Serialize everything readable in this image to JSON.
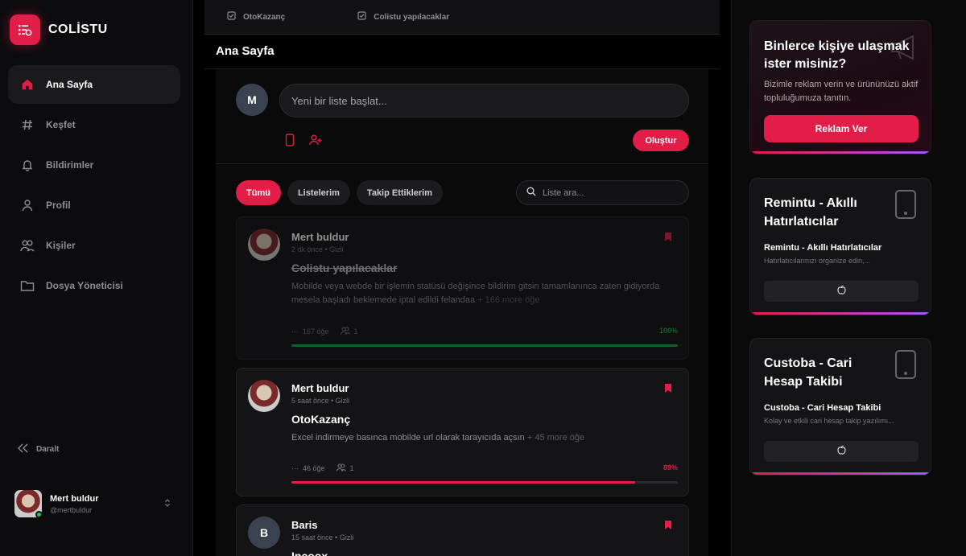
{
  "app": {
    "name": "COLİSTU"
  },
  "sidebar": {
    "items": [
      {
        "label": "Ana Sayfa",
        "icon": "home-icon",
        "active": true
      },
      {
        "label": "Keşfet",
        "icon": "hash-icon"
      },
      {
        "label": "Bildirimler",
        "icon": "bell-icon"
      },
      {
        "label": "Profil",
        "icon": "user-icon"
      },
      {
        "label": "Kişiler",
        "icon": "users-icon"
      },
      {
        "label": "Dosya Yöneticisi",
        "icon": "folder-icon"
      }
    ],
    "collapse_label": "Daralt",
    "user": {
      "name": "Mert buldur",
      "handle": "@mertbuldur"
    }
  },
  "topbar": {
    "tabs": [
      "OtoKazanç",
      "Colistu yapılacaklar"
    ]
  },
  "main": {
    "page_title": "Ana Sayfa",
    "composer": {
      "avatar_initial": "M",
      "placeholder": "Yeni bir liste başlat...",
      "create_label": "Oluştur"
    },
    "filters": [
      "Tümü",
      "Listelerim",
      "Takip Ettiklerim"
    ],
    "search_placeholder": "Liste ara...",
    "posts": [
      {
        "author": "Mert buldur",
        "meta": "2 dk önce • Gizli",
        "title": "Colistu yapılacaklar",
        "description": "Mobilde veya webde bir işlemin statüsü değişince bildirim gitsin tamamlanınca zaten gidiyorda mesela başladı beklemede iptal edildi felandaa",
        "more": "+ 166 more öğe",
        "items": "167 öğe",
        "members": "1",
        "percent": "100%",
        "progress": 1.0,
        "color": "#22a34a"
      },
      {
        "author": "Mert buldur",
        "meta": "5 saat önce • Gizli",
        "title": "OtoKazanç",
        "description": "Excel indirmeye basınca mobilde url olarak tarayıcıda açsın",
        "more": "+ 45 more öğe",
        "items": "46 öğe",
        "members": "1",
        "percent": "89%",
        "progress": 0.89,
        "color": "#e11d48"
      },
      {
        "author": "Baris",
        "avatar_initial": "B",
        "meta": "15 saat önce • Gizli",
        "title": "Incoox"
      }
    ]
  },
  "rail": {
    "ad": {
      "title": "Binlerce kişiye ulaşmak ister misiniz?",
      "description": "Bizimle reklam verin ve ürününüzü aktif topluluğumuza tanıtın.",
      "button": "Reklam Ver"
    },
    "apps": [
      {
        "title": "Remintu - Akıllı Hatırlatıcılar",
        "subtitle": "Remintu - Akıllı Hatırlatıcılar",
        "description": "Hatırlatıcılarınızı organize edin,..."
      },
      {
        "title": "Custoba - Cari Hesap Takibi",
        "subtitle": "Custoba - Cari Hesap Takibi",
        "description": "Kolay ve etkili cari hesap takip yazılımı..."
      }
    ]
  },
  "colors": {
    "accent": "#e11d48",
    "success": "#22a34a",
    "background": "#000000"
  }
}
